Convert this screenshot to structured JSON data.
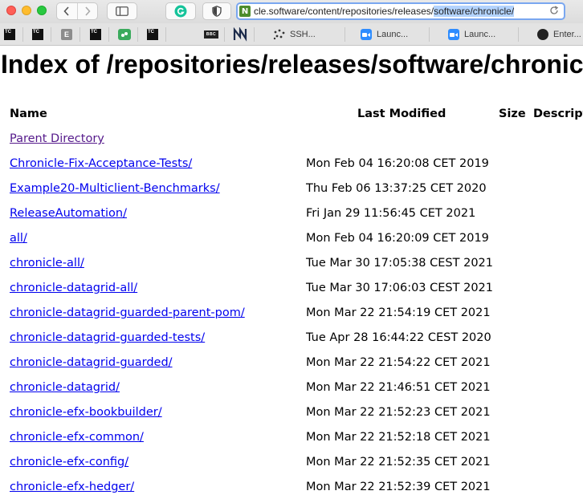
{
  "browser": {
    "url_prefix": "cle.software/content/repositories/releases/",
    "url_selected": "software/chronicle/",
    "site_icon_letter": "N",
    "bookmarks": [
      {
        "icon": "tc-icon",
        "label": "TC"
      },
      {
        "icon": "tc-icon",
        "label": "TC"
      },
      {
        "icon": "e-icon",
        "label": "E"
      },
      {
        "icon": "tc-icon",
        "label": "TC"
      },
      {
        "icon": "green-app-icon",
        "label": ""
      },
      {
        "icon": "tc-icon",
        "label": "TC"
      },
      {
        "icon": "bbc-icon",
        "label": "BBC"
      },
      {
        "icon": "n-logo-icon",
        "label": ""
      },
      {
        "icon": "ssh-icon",
        "label": "SSH..."
      },
      {
        "icon": "zoom-icon",
        "label": "Launc..."
      },
      {
        "icon": "zoom-icon",
        "label": "Launc..."
      },
      {
        "icon": "github-icon",
        "label": "Enter..."
      }
    ]
  },
  "page": {
    "title": "Index of /repositories/releases/software/chronicle/",
    "columns": {
      "name": "Name",
      "modified": "Last Modified",
      "size": "Size",
      "description": "Description"
    },
    "rows": [
      {
        "name": "Parent Directory",
        "date": "",
        "visited": true
      },
      {
        "name": "Chronicle-Fix-Acceptance-Tests/",
        "date": "Mon Feb 04 16:20:08 CET 2019"
      },
      {
        "name": "Example20-Multiclient-Benchmarks/",
        "date": "Thu Feb 06 13:37:25 CET 2020"
      },
      {
        "name": "ReleaseAutomation/",
        "date": "Fri Jan 29 11:56:45 CET 2021"
      },
      {
        "name": "all/",
        "date": "Mon Feb 04 16:20:09 CET 2019"
      },
      {
        "name": "chronicle-all/",
        "date": "Tue Mar 30 17:05:38 CEST 2021"
      },
      {
        "name": "chronicle-datagrid-all/",
        "date": "Tue Mar 30 17:06:03 CEST 2021"
      },
      {
        "name": "chronicle-datagrid-guarded-parent-pom/",
        "date": "Mon Mar 22 21:54:19 CET 2021"
      },
      {
        "name": "chronicle-datagrid-guarded-tests/",
        "date": "Tue Apr 28 16:44:22 CEST 2020"
      },
      {
        "name": "chronicle-datagrid-guarded/",
        "date": "Mon Mar 22 21:54:22 CET 2021"
      },
      {
        "name": "chronicle-datagrid/",
        "date": "Mon Mar 22 21:46:51 CET 2021"
      },
      {
        "name": "chronicle-efx-bookbuilder/",
        "date": "Mon Mar 22 21:52:23 CET 2021"
      },
      {
        "name": "chronicle-efx-common/",
        "date": "Mon Mar 22 21:52:18 CET 2021"
      },
      {
        "name": "chronicle-efx-config/",
        "date": "Mon Mar 22 21:52:35 CET 2021"
      },
      {
        "name": "chronicle-efx-hedger/",
        "date": "Mon Mar 22 21:52:39 CET 2021"
      }
    ]
  }
}
